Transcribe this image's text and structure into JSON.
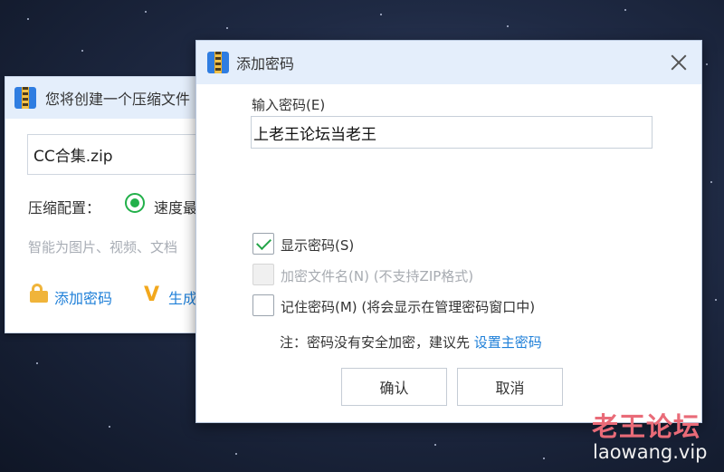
{
  "back_window": {
    "title": "您将创建一个压缩文件",
    "filename": "CC合集.zip",
    "config_label": "压缩配置：",
    "radio_label": "速度最",
    "description": "智能为图片、视频、文档",
    "add_password": "添加密码",
    "generate_label": "生成"
  },
  "dialog": {
    "title": "添加密码",
    "password_label": "输入密码(E)",
    "password_value": "上老王论坛当老王",
    "show_password_label": "显示密码(S)",
    "show_password_checked": true,
    "encrypt_filename_label": "加密文件名(N) (不支持ZIP格式)",
    "encrypt_filename_enabled": false,
    "remember_password_label": "记住密码(M) (将会显示在管理密码窗口中)",
    "remember_password_checked": false,
    "note_text": "注：密码没有安全加密，建议先 ",
    "note_link": "设置主密码",
    "ok_label": "确认",
    "cancel_label": "取消"
  },
  "watermark": {
    "chinese": "老王论坛",
    "url": "laowang.vip"
  },
  "colors": {
    "accent_green": "#22b04a",
    "link_blue": "#1e7fd8",
    "titlebar_bg": "#e4eefb",
    "watermark_red": "#e96b78"
  }
}
